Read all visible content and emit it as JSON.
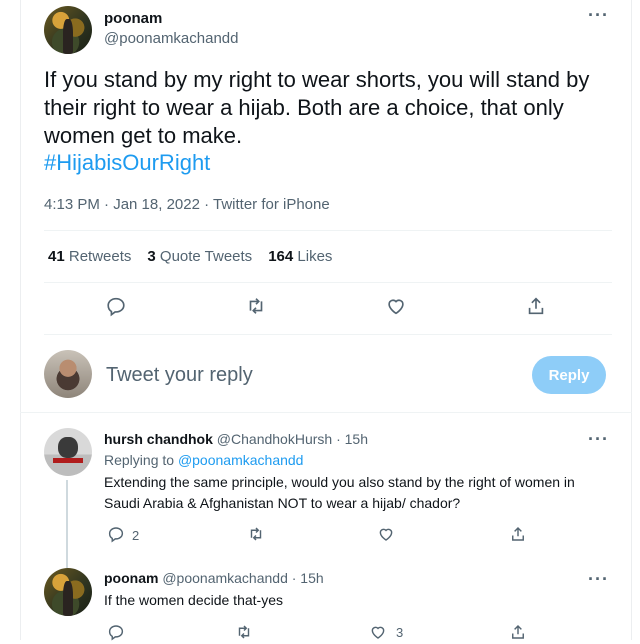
{
  "main_tweet": {
    "display_name": "poonam",
    "handle": "@poonamkachandd",
    "text": "If you stand by my right to wear shorts, you will stand by their right to wear a hijab. Both are a choice, that only women get to make.",
    "hashtag": "#HijabisOurRight",
    "meta": "4:13 PM · Jan 18, 2022 · Twitter for iPhone",
    "stats": {
      "retweets_count": "41",
      "retweets_label": "Retweets",
      "quotes_count": "3",
      "quotes_label": "Quote Tweets",
      "likes_count": "164",
      "likes_label": "Likes"
    }
  },
  "reply_box": {
    "placeholder": "Tweet your reply",
    "button_label": "Reply"
  },
  "replies": [
    {
      "display_name": "hursh chandhok",
      "handle_time": "@ChandhokHursh · 15h",
      "replying_to_label": "Replying to",
      "replying_to_handle": "@poonamkachandd",
      "text": "Extending the same principle, would you also stand by the right of women in Saudi Arabia & Afghanistan NOT to wear a hijab/ chador?",
      "reply_count": "2"
    },
    {
      "display_name": "poonam",
      "handle_time": "@poonamkachandd · 15h",
      "text": "If the women decide that-yes",
      "like_count": "3"
    }
  ],
  "colors": {
    "accent": "#1d9bf0",
    "secondary_text": "#536471",
    "reply_button": "#8ecdf8"
  }
}
